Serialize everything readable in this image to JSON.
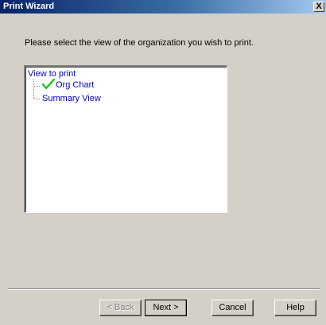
{
  "window": {
    "title": "Print Wizard",
    "close_glyph": "X"
  },
  "instruction": "Please select the view of the organization you wish to print.",
  "tree": {
    "root_label": "View to print",
    "items": [
      {
        "label": "Org Chart",
        "checked": true,
        "icon": "checkmark-icon"
      },
      {
        "label": "Summary View",
        "checked": false
      }
    ]
  },
  "buttons": {
    "back": "< Back",
    "next": "Next >",
    "cancel": "Cancel",
    "help": "Help"
  },
  "colors": {
    "title_bar": "#0a246a",
    "tree_text": "#0000cc",
    "checkmark": "#00cc00",
    "dialog_bg": "#d4d0c8"
  }
}
